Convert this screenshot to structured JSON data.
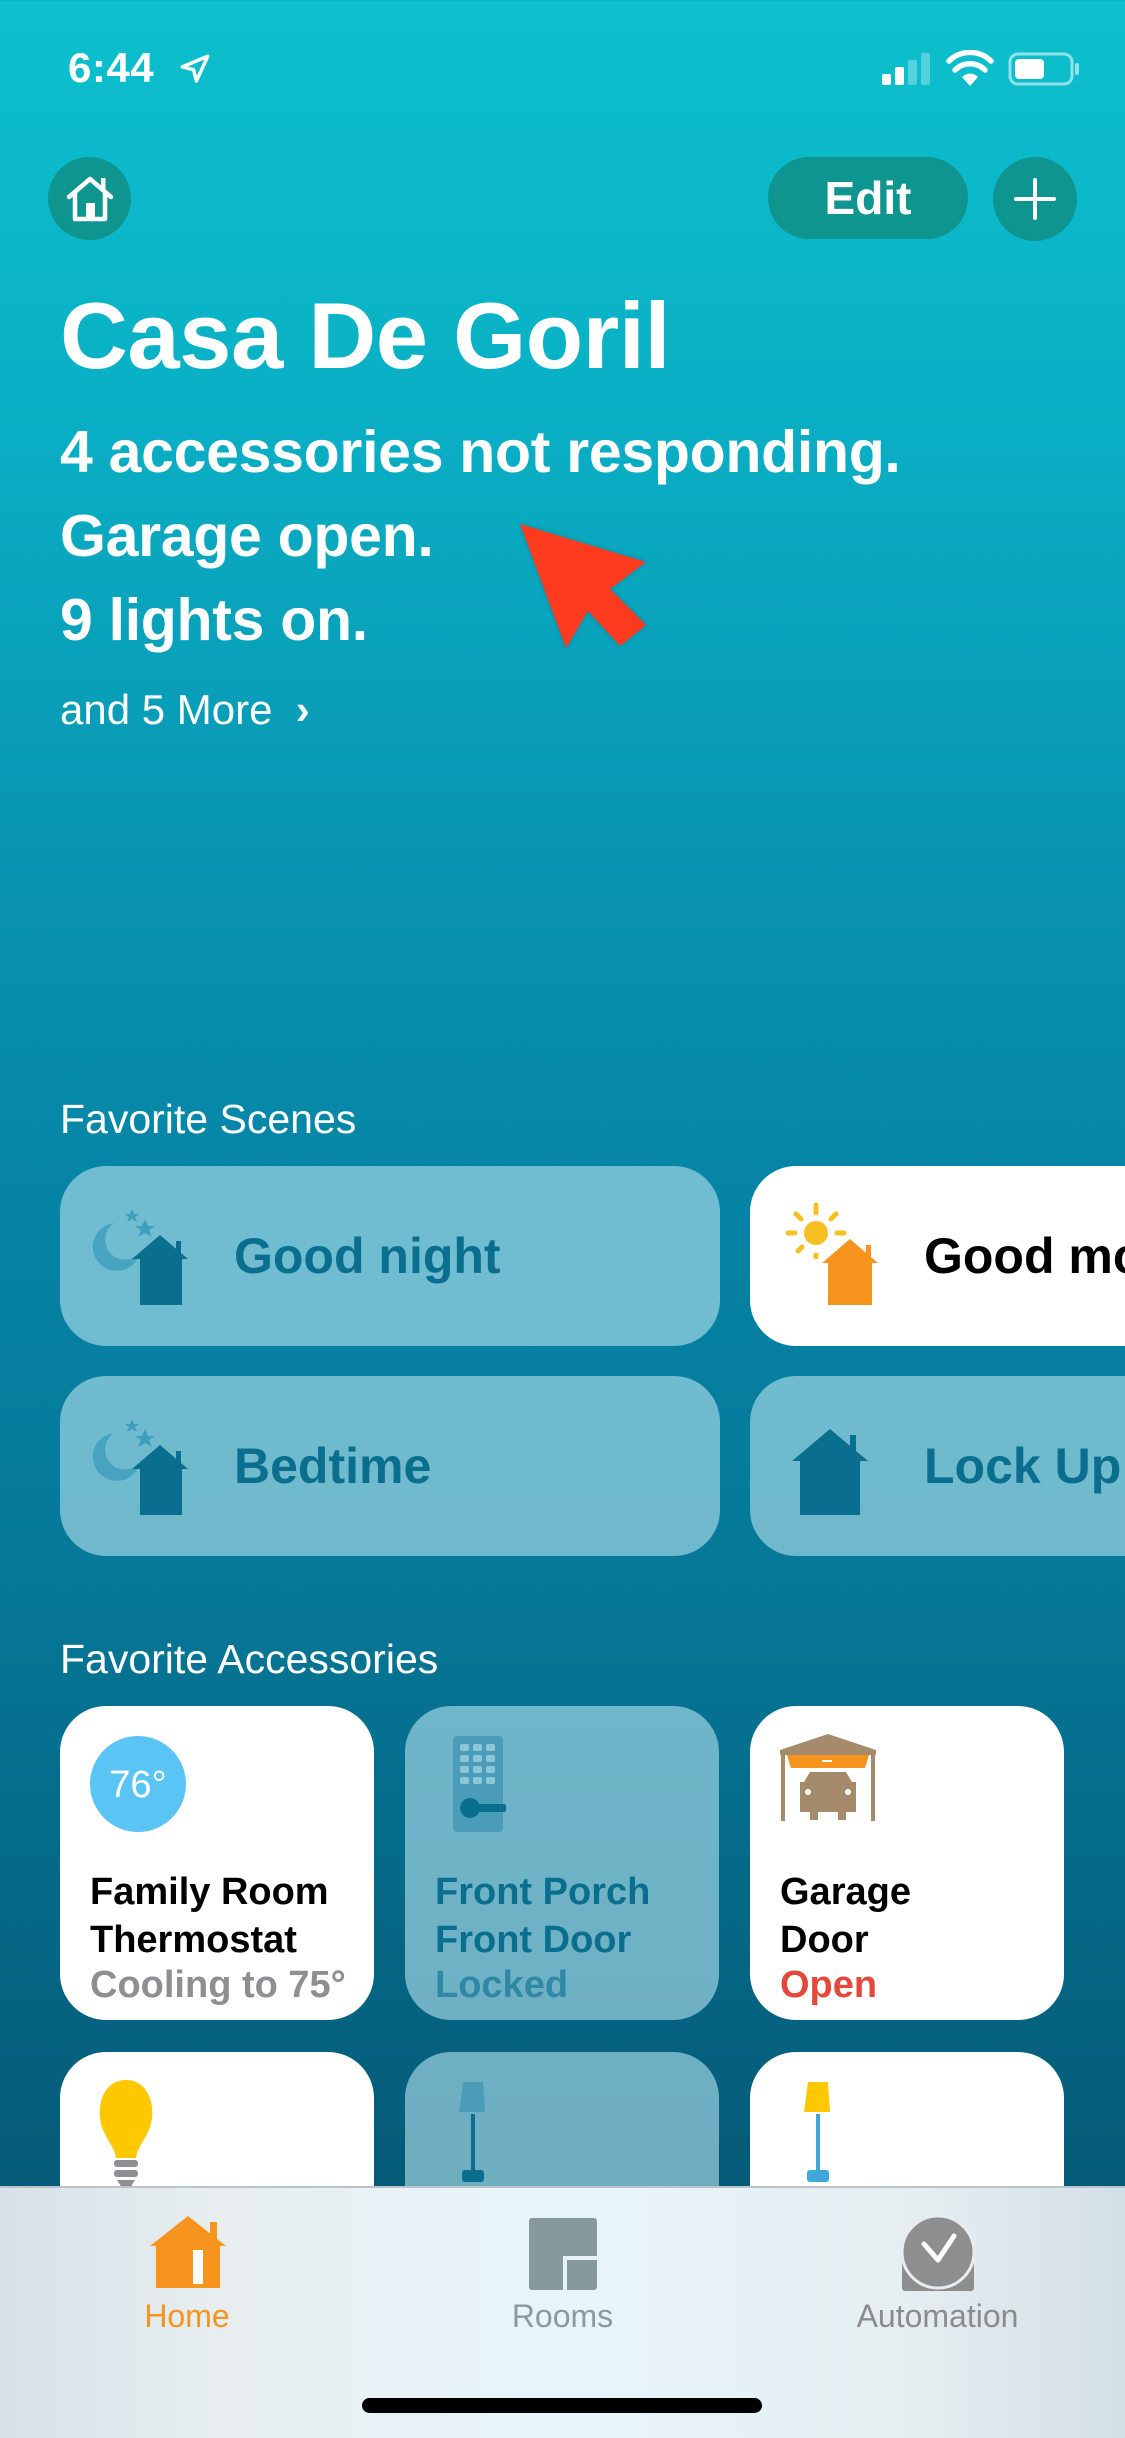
{
  "status_bar": {
    "time": "6:44",
    "location_icon": "location-arrow-icon",
    "signal_bars_active": 2,
    "signal_bars_total": 4,
    "wifi_icon": "wifi-icon",
    "battery_level": 0.55
  },
  "header": {
    "home_button_icon": "house-icon",
    "edit_label": "Edit",
    "add_button_icon": "plus-icon"
  },
  "home": {
    "title": "Casa De Goril",
    "status_lines": [
      "4 accessories not responding.",
      "Garage open.",
      "9 lights on."
    ],
    "more_link": "and 5 More"
  },
  "annotation": {
    "type": "red-arrow",
    "color": "#ff3b1f"
  },
  "scenes": {
    "title": "Favorite Scenes",
    "items": [
      {
        "label": "Good night",
        "icon": "moon-stars-house-icon",
        "active": false
      },
      {
        "label": "Good morning",
        "icon": "sun-house-icon",
        "active": true
      },
      {
        "label": "Bedtime",
        "icon": "moon-stars-house-icon",
        "active": false
      },
      {
        "label": "Lock Up",
        "icon": "house-icon",
        "active": false
      }
    ]
  },
  "accessories": {
    "title": "Favorite Accessories",
    "items": [
      {
        "name_line1": "Family Room",
        "name_line2": "Thermostat",
        "state": "Cooling to 75°",
        "icon": "thermostat-icon",
        "temp_display": "76°",
        "active": true,
        "state_color": "#8e8e93"
      },
      {
        "name_line1": "Front Porch",
        "name_line2": "Front Door",
        "state": "Locked",
        "icon": "door-lock-icon",
        "active": false,
        "state_color": "#2f88a6"
      },
      {
        "name_line1": "Garage",
        "name_line2": "Door",
        "state": "Open",
        "icon": "garage-door-icon",
        "active": true,
        "state_color": "#e5473b"
      },
      {
        "name_line1": "",
        "name_line2": "",
        "state": "",
        "icon": "lightbulb-icon",
        "active": true
      },
      {
        "name_line1": "",
        "name_line2": "",
        "state": "",
        "icon": "floor-lamp-icon",
        "active": false
      },
      {
        "name_line1": "",
        "name_line2": "",
        "state": "",
        "icon": "floor-lamp-icon",
        "active": true
      }
    ]
  },
  "tab_bar": {
    "tabs": [
      {
        "label": "Home",
        "icon": "house-icon",
        "selected": true
      },
      {
        "label": "Rooms",
        "icon": "rooms-icon",
        "selected": false
      },
      {
        "label": "Automation",
        "icon": "automation-clock-icon",
        "selected": false
      }
    ]
  },
  "colors": {
    "accent_orange": "#f7941d",
    "header_button": "#0f958f",
    "tile_off_text": "#0a6f8f",
    "alert_red": "#e5473b"
  }
}
